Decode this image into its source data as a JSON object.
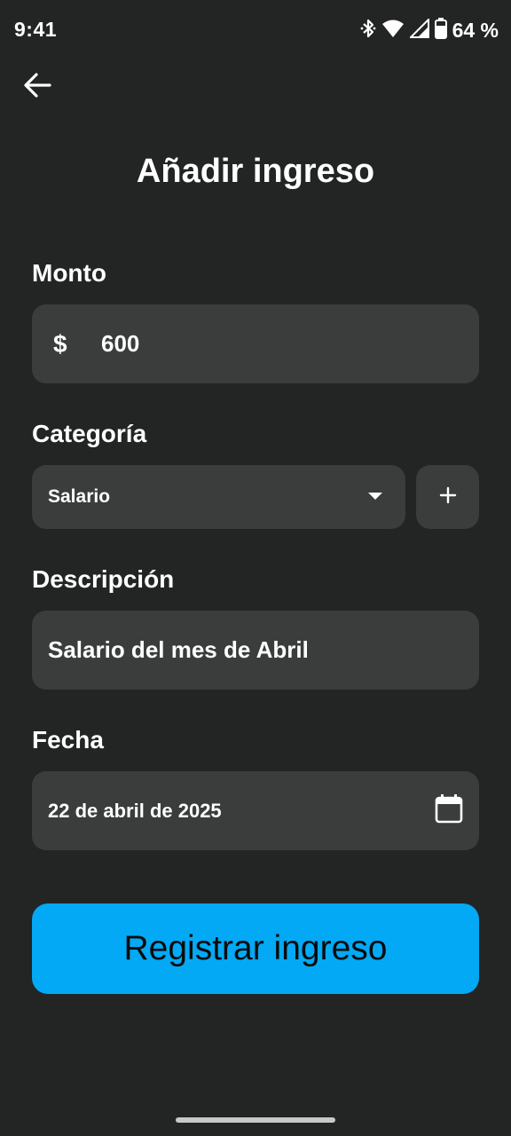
{
  "status_bar": {
    "time": "9:41",
    "battery": "64 %"
  },
  "header": {
    "title": "Añadir ingreso"
  },
  "form": {
    "amount": {
      "label": "Monto",
      "currency_symbol": "$",
      "value": "600"
    },
    "category": {
      "label": "Categoría",
      "selected": "Salario",
      "add_label": "+"
    },
    "description": {
      "label": "Descripción",
      "value": "Salario del mes de Abril"
    },
    "date": {
      "label": "Fecha",
      "value": "22 de abril de 2025"
    }
  },
  "submit": {
    "label": "Registrar ingreso"
  },
  "colors": {
    "background": "#232424",
    "field": "#3b3c3c",
    "accent": "#03a9f4"
  },
  "icons": [
    "bluetooth-icon",
    "wifi-icon",
    "signal-icon",
    "battery-icon",
    "back-arrow-icon",
    "dropdown-arrow-icon",
    "calendar-icon"
  ]
}
